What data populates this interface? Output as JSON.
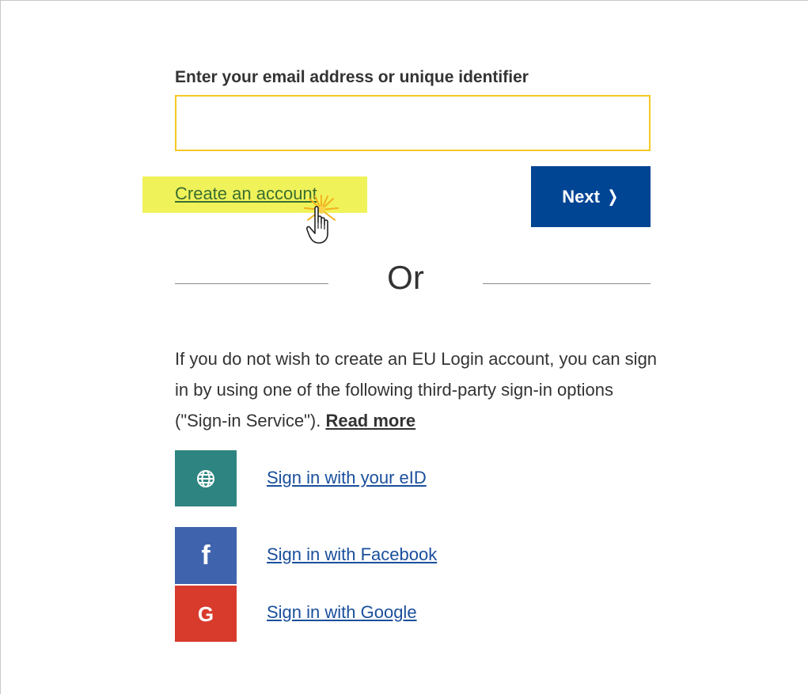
{
  "login_form": {
    "field_label": "Enter your email address or unique identifier",
    "email_value": "",
    "email_placeholder": "",
    "create_account_link": "Create an account",
    "next_button_label": "Next",
    "next_chevron": "❭"
  },
  "divider": {
    "or_label": "Or"
  },
  "third_party": {
    "info_text": "If you do not wish to create an EU Login account, you can sign in by using one of the following third-party sign-in options (\"Sign-in Service\"). ",
    "read_more_link": "Read more",
    "options": [
      {
        "icon": "globe-icon",
        "label": "Sign in with your eID",
        "color": "#2e8480"
      },
      {
        "icon": "facebook-icon",
        "glyph": "f",
        "label": "Sign in with Facebook",
        "color": "#3f63ad"
      },
      {
        "icon": "google-icon",
        "glyph": "G",
        "label": "Sign in with Google",
        "color": "#d83b2c"
      }
    ]
  },
  "colors": {
    "input_border": "#f5c824",
    "highlight": "#f0f25a",
    "next_button": "#004494",
    "link": "#1a4f9c",
    "create_link": "#3a6e30"
  }
}
